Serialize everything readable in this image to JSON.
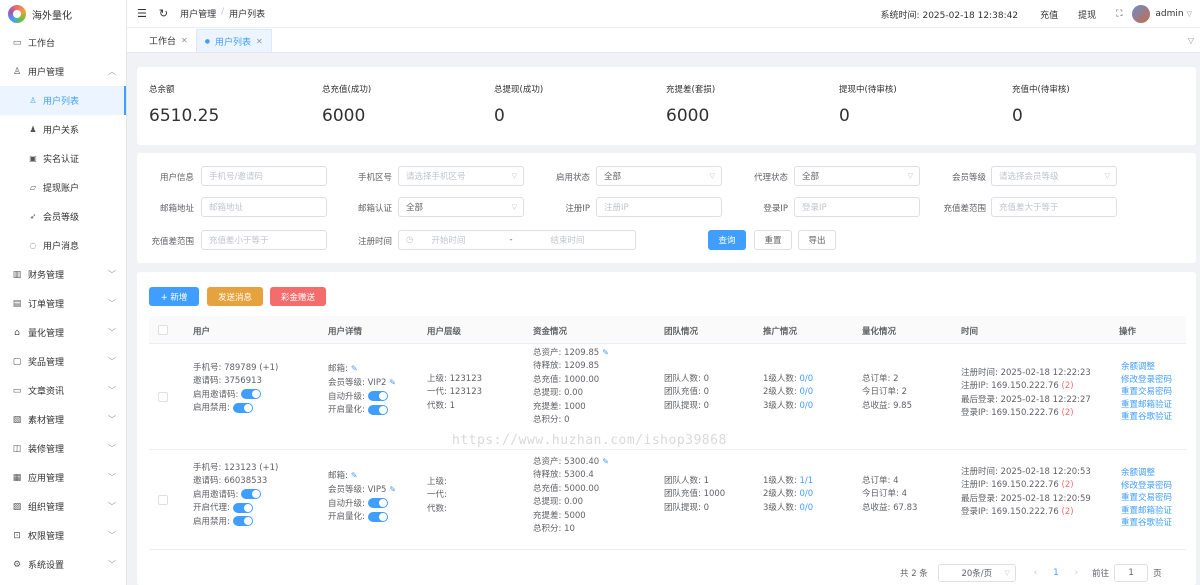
{
  "brand": {
    "name": "海外量化"
  },
  "sidebar": {
    "items": [
      {
        "label": "工作台",
        "icon": "monitor-icon",
        "glyph": "▭"
      },
      {
        "label": "用户管理",
        "icon": "user-icon",
        "glyph": "♙",
        "expanded": true
      }
    ],
    "sub": [
      {
        "label": "用户列表",
        "icon": "user-list-icon",
        "glyph": "♙",
        "active": true
      },
      {
        "label": "用户关系",
        "icon": "user-relation-icon",
        "glyph": "♟"
      },
      {
        "label": "实名认证",
        "icon": "idcard-icon",
        "glyph": "▣"
      },
      {
        "label": "提现账户",
        "icon": "folder-icon",
        "glyph": "▱"
      },
      {
        "label": "会员等级",
        "icon": "rocket-icon",
        "glyph": "➶"
      },
      {
        "label": "用户消息",
        "icon": "chat-icon",
        "glyph": "◌"
      }
    ],
    "groups": [
      {
        "label": "财务管理",
        "icon": "chart-icon",
        "glyph": "▥"
      },
      {
        "label": "订单管理",
        "icon": "order-icon",
        "glyph": "▤"
      },
      {
        "label": "量化管理",
        "icon": "quant-icon",
        "glyph": "⌂"
      },
      {
        "label": "奖品管理",
        "icon": "gift-icon",
        "glyph": "▢"
      },
      {
        "label": "文章资讯",
        "icon": "article-icon",
        "glyph": "▭"
      },
      {
        "label": "素材管理",
        "icon": "material-icon",
        "glyph": "▧"
      },
      {
        "label": "装修管理",
        "icon": "decorate-icon",
        "glyph": "◫"
      },
      {
        "label": "应用管理",
        "icon": "app-icon",
        "glyph": "▦"
      },
      {
        "label": "组织管理",
        "icon": "org-icon",
        "glyph": "▨"
      },
      {
        "label": "权限管理",
        "icon": "lock-icon",
        "glyph": "⊡"
      },
      {
        "label": "系统设置",
        "icon": "settings-icon",
        "glyph": "⚙"
      }
    ]
  },
  "header": {
    "breadcrumb": [
      "用户管理",
      "用户列表"
    ],
    "system_time_label": "系统时间:",
    "system_time": "2025-02-18 12:38:42",
    "recharge": "充值",
    "withdraw": "提现",
    "user": "admin"
  },
  "tabs": [
    {
      "label": "工作台",
      "active": false
    },
    {
      "label": "用户列表",
      "active": true
    }
  ],
  "stats": [
    {
      "label": "总余额",
      "value": "6510.25"
    },
    {
      "label": "总充值(成功)",
      "value": "6000"
    },
    {
      "label": "总提现(成功)",
      "value": "0"
    },
    {
      "label": "充提差(套损)",
      "value": "6000"
    },
    {
      "label": "提现中(待审核)",
      "value": "0"
    },
    {
      "label": "充值中(待审核)",
      "value": "0"
    }
  ],
  "filters": {
    "row1": [
      {
        "label": "用户信息",
        "placeholder": "手机号/邀请码",
        "select": false
      },
      {
        "label": "手机区号",
        "placeholder": "请选择手机区号",
        "select": true
      },
      {
        "label": "启用状态",
        "value": "全部",
        "select": true
      },
      {
        "label": "代理状态",
        "value": "全部",
        "select": true
      },
      {
        "label": "会员等级",
        "placeholder": "请选择会员等级",
        "select": true
      }
    ],
    "row2": [
      {
        "label": "邮箱地址",
        "placeholder": "邮箱地址",
        "select": false
      },
      {
        "label": "邮箱认证",
        "value": "全部",
        "select": true
      },
      {
        "label": "注册IP",
        "placeholder": "注册IP",
        "select": false
      },
      {
        "label": "登录IP",
        "placeholder": "登录IP",
        "select": false
      },
      {
        "label": "充值差范围",
        "placeholder": "充值差大于等于",
        "select": false
      }
    ],
    "row3": {
      "range_label": "充值差范围",
      "range_placeholder": "充值差小于等于",
      "time_label": "注册时间",
      "start_placeholder": "开始时间",
      "dash": "-",
      "end_placeholder": "结束时间",
      "query": "查询",
      "reset": "重置",
      "export": "导出"
    }
  },
  "actions": {
    "add": "+ 新增",
    "send_msg": "发送消息",
    "bonus": "彩金赠送"
  },
  "table": {
    "headers": [
      "用户",
      "用户详情",
      "用户层级",
      "资金情况",
      "团队情况",
      "推广情况",
      "量化情况",
      "时间",
      "操作"
    ],
    "rows": [
      {
        "user": [
          "手机号: 789789 (+1)",
          "邀请码: 3756913",
          "启用邀请码:",
          "启用禁用:"
        ],
        "detail": [
          "邮箱:",
          "会员等级: VIP2",
          "自动升级:",
          "开启量化:"
        ],
        "level": [
          "上级: 123123",
          "一代: 123123",
          "代数: 1"
        ],
        "funds": [
          "总资产: 1209.85",
          "待释放: 1209.85",
          "总充值: 1000.00",
          "总提现: 0.00",
          "充提差: 1000",
          "总积分: 0"
        ],
        "team": [
          "团队人数: 0",
          "团队充值: 0",
          "团队提现: 0"
        ],
        "promo": [
          {
            "label": "1级人数:",
            "val": "0/0"
          },
          {
            "label": "2级人数:",
            "val": "0/0"
          },
          {
            "label": "3级人数:",
            "val": "0/0"
          }
        ],
        "quant": [
          "总订单: 2",
          "今日订单: 2",
          "总收益: 9.85"
        ],
        "time": [
          {
            "text": "注册时间: 2025-02-18 12:22:23",
            "count": ""
          },
          {
            "text": "注册IP: 169.150.222.76",
            "count": "(2)"
          },
          {
            "text": "最后登录: 2025-02-18 12:22:27",
            "count": ""
          },
          {
            "text": "登录IP: 169.150.222.76",
            "count": "(2)"
          }
        ],
        "ops": [
          "余额调整",
          "修改登录密码",
          "重置交易密码",
          "重置邮箱验证",
          "重置谷歌验证"
        ]
      },
      {
        "user": [
          "手机号: 123123 (+1)",
          "邀请码: 66038533",
          "启用邀请码:",
          "开启代理:",
          "启用禁用:"
        ],
        "detail": [
          "邮箱:",
          "会员等级: VIP5",
          "自动升级:",
          "开启量化:"
        ],
        "level": [
          "上级:",
          "一代:",
          "代数:"
        ],
        "funds": [
          "总资产: 5300.40",
          "待释放: 5300.4",
          "总充值: 5000.00",
          "总提现: 0.00",
          "充提差: 5000",
          "总积分: 10"
        ],
        "team": [
          "团队人数: 1",
          "团队充值: 1000",
          "团队提现: 0"
        ],
        "promo": [
          {
            "label": "1级人数:",
            "val": "1/1"
          },
          {
            "label": "2级人数:",
            "val": "0/0"
          },
          {
            "label": "3级人数:",
            "val": "0/0"
          }
        ],
        "quant": [
          "总订单: 4",
          "今日订单: 4",
          "总收益: 67.83"
        ],
        "time": [
          {
            "text": "注册时间: 2025-02-18 12:20:53",
            "count": ""
          },
          {
            "text": "注册IP: 169.150.222.76",
            "count": "(2)"
          },
          {
            "text": "最后登录: 2025-02-18 12:20:59",
            "count": ""
          },
          {
            "text": "登录IP: 169.150.222.76",
            "count": "(2)"
          }
        ],
        "ops": [
          "余额调整",
          "修改登录密码",
          "重置交易密码",
          "重置邮箱验证",
          "重置谷歌验证"
        ]
      }
    ]
  },
  "watermark": "https://www.huzhan.com/ishop39868",
  "pager": {
    "total": "共 2 条",
    "size": "20条/页",
    "current": "1",
    "goto": "前往",
    "page": "1",
    "unit": "页"
  },
  "colors": {
    "primary": "#409eff",
    "warning": "#e6a23c",
    "danger": "#f56c6c"
  }
}
